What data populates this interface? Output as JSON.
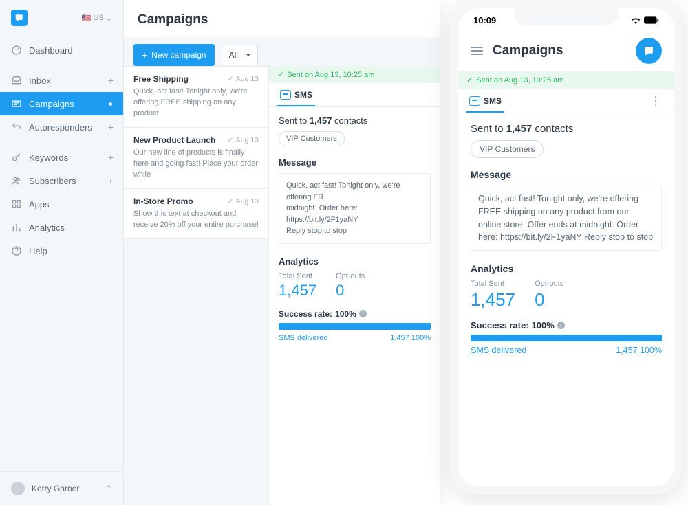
{
  "locale": "US",
  "page_title": "Campaigns",
  "toolbar": {
    "new_campaign": "New campaign",
    "filter": "All"
  },
  "nav": {
    "dashboard": "Dashboard",
    "inbox": "Inbox",
    "campaigns": "Campaigns",
    "autoresponders": "Autoresponders",
    "keywords": "Keywords",
    "subscribers": "Subscribers",
    "apps": "Apps",
    "analytics": "Analytics",
    "help": "Help"
  },
  "user": {
    "name": "Kerry Garner"
  },
  "campaigns": [
    {
      "title": "Free Shipping",
      "date": "Aug 13",
      "desc": "Quick, act fast! Tonight only, we're offering FREE shipping on any product"
    },
    {
      "title": "New Product Launch",
      "date": "Aug 13",
      "desc": "Our new line of products is finally here and going fast! Place your order while"
    },
    {
      "title": "In-Store Promo",
      "date": "Aug 13",
      "desc": "Show this text at checkout and receive 20% off your entire purchase!"
    }
  ],
  "detail": {
    "sent_banner": "Sent on Aug 13, 10:25 am",
    "channel": "SMS",
    "sent_to_prefix": "Sent to",
    "sent_to_count": "1,457",
    "sent_to_suffix": "contacts",
    "segment": "VIP Customers",
    "message_label": "Message",
    "message_text_short": "Quick, act fast! Tonight only, we're offering FR\nmidnight. Order here: https://bit.ly/2F1yaNY\nReply stop to stop",
    "message_text_full": "Quick, act fast! Tonight only, we're offering FREE shipping on any product from our online store. Offer ends at midnight. Order here: https://bit.ly/2F1yaNY Reply stop to stop",
    "analytics_label": "Analytics",
    "total_sent_label": "Total Sent",
    "total_sent_value": "1,457",
    "optouts_label": "Opt-outs",
    "optouts_value": "0",
    "success_label": "Success rate:",
    "success_value": "100%",
    "delivered_label": "SMS delivered",
    "delivered_value": "1,457",
    "delivered_pct": "100%"
  },
  "phone": {
    "time": "10:09",
    "title": "Campaigns"
  }
}
